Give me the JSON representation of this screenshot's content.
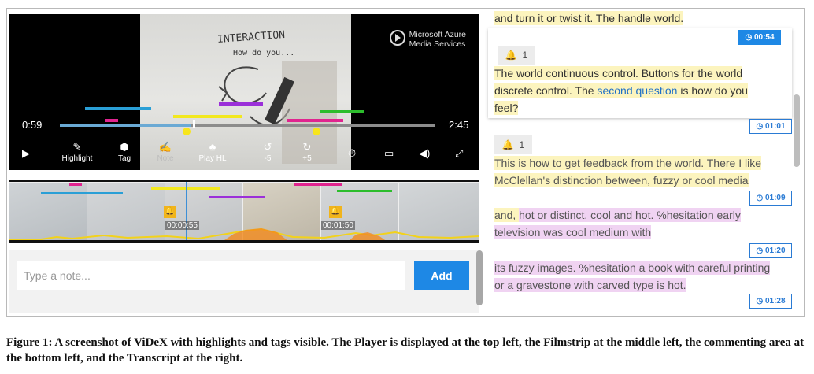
{
  "player": {
    "current_time": "0:59",
    "duration": "2:45",
    "progress": 0.35,
    "brand_line1": "Microsoft Azure",
    "brand_line2": "Media Services",
    "whiteboard_title": "INTERACTION",
    "whiteboard_sub": "How do you...",
    "controls": [
      {
        "icon": "▶",
        "label": ""
      },
      {
        "icon": "✎",
        "label": "Highlight"
      },
      {
        "icon": "⬢",
        "label": "Tag"
      },
      {
        "icon": "✍",
        "label": "Note"
      },
      {
        "icon": "♣",
        "label": "Play HL"
      },
      {
        "icon": "↺",
        "label": "-5"
      },
      {
        "icon": "↻",
        "label": "+5"
      },
      {
        "icon": "⏱",
        "label": ""
      },
      {
        "icon": "▭",
        "label": ""
      },
      {
        "icon": "◀)",
        "label": ""
      },
      {
        "icon": "⤢",
        "label": ""
      }
    ]
  },
  "filmstrip": {
    "markers": [
      "00:00:55",
      "00:01:50"
    ]
  },
  "notes": {
    "placeholder": "Type a note...",
    "add_label": "Add"
  },
  "transcript": {
    "top_line": "and turn it or twist it. The handle world.",
    "stamps": [
      "00:54",
      "01:01",
      "01:09",
      "01:20",
      "01:28"
    ],
    "badges": [
      "1",
      "1"
    ],
    "active_line1": "The world continuous control. Buttons for the world",
    "active_line2_a": "discrete control. The ",
    "active_line2_kw": "second question",
    "active_line2_b": " is ",
    "active_line2_c": "how do you",
    "active_line3": "feel?",
    "seg2_line1": "This is how to get feedback from the world. There I like",
    "seg2_line2": "McClellan's distinction between, fuzzy or cool media",
    "seg3_line1_a": "and, ",
    "seg3_line1_b": "hot or distinct. cool and hot. %hesitation early",
    "seg3_line2": "television was cool medium with",
    "seg4_line1": "its fuzzy images. %hesitation a book with careful printing",
    "seg4_line2": "or a gravestone with carved type is hot."
  },
  "caption": {
    "text": "Figure 1: A screenshot of ViDeX with highlights and tags visible. The Player is displayed at the top left, the Filmstrip at the middle left, the commenting area at the bottom left, and the Transcript at the right."
  },
  "colors": {
    "accent": "#1e88e5",
    "highlight_yellow": "#fcf4be",
    "highlight_pink": "#f0d3f2",
    "bar_blue": "#2a9fd6",
    "bar_purple": "#9b30d9",
    "bar_yellow": "#f2e81e",
    "bar_magenta": "#e0248f",
    "bar_green": "#2cbd2c"
  }
}
